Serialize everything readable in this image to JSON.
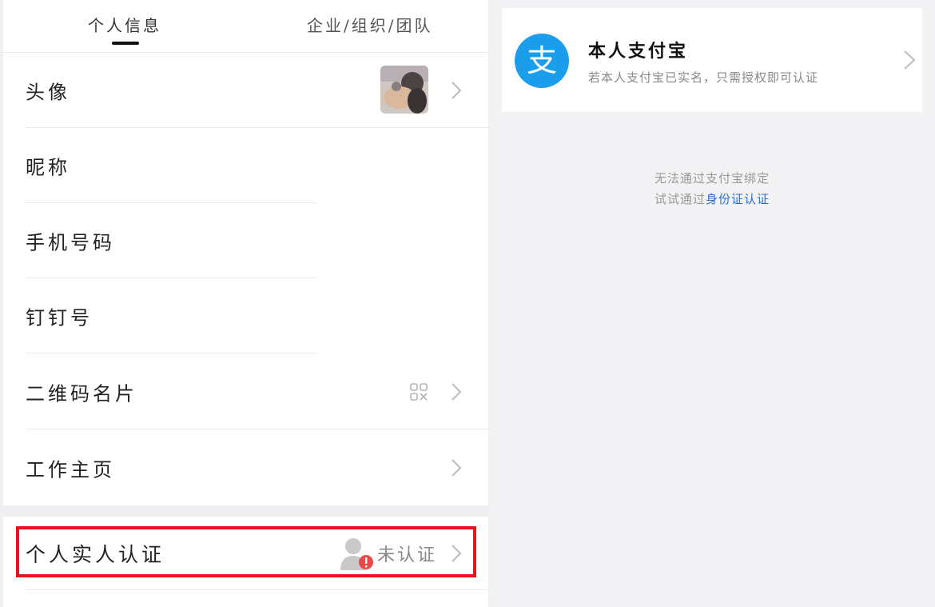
{
  "tabs": {
    "personal": "个人信息",
    "org": "企业/组织/团队"
  },
  "rows": {
    "avatar": "头像",
    "nickname": "昵称",
    "phone": "手机号码",
    "dingtalk_id": "钉钉号",
    "qr_card": "二维码名片",
    "work_home": "工作主页",
    "real_name": "个人实人认证"
  },
  "real_name_status": "未认证",
  "alipay": {
    "title": "本人支付宝",
    "subtitle": "若本人支付宝已实名，只需授权即可认证",
    "logo_glyph": "支"
  },
  "fallback": {
    "line1": "无法通过支付宝绑定",
    "line2_prefix": "试试通过",
    "line2_link": "身份证认证"
  },
  "icons": {
    "chevron": "chevron-right-icon",
    "qr": "qr-code-icon",
    "person": "person-alert-icon",
    "alipay": "alipay-logo"
  },
  "colors": {
    "alipay_blue": "#1a9dea",
    "highlight_red": "#e8131c",
    "link_blue": "#2e6fce",
    "alert_red": "#e84a4a"
  }
}
